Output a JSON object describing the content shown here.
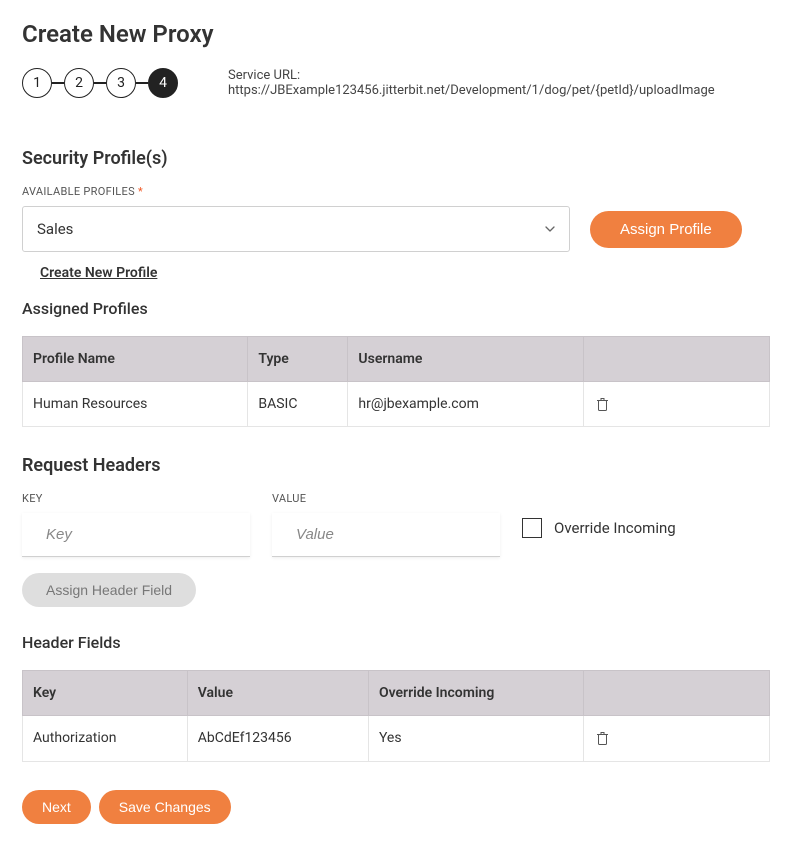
{
  "page_title": "Create New Proxy",
  "stepper": {
    "steps": [
      "1",
      "2",
      "3",
      "4"
    ],
    "active_index": 3
  },
  "service_url_label": "Service URL:",
  "service_url": "https://JBExample123456.jitterbit.net/Development/1/dog/pet/{petId}/uploadImage",
  "security": {
    "heading": "Security Profile(s)",
    "available_label": "AVAILABLE PROFILES",
    "selected_value": "Sales",
    "assign_button": "Assign Profile",
    "create_link": "Create New Profile",
    "assigned_title": "Assigned Profiles",
    "columns": [
      "Profile Name",
      "Type",
      "Username",
      ""
    ],
    "rows": [
      {
        "profile_name": "Human Resources",
        "type": "BASIC",
        "username": "hr@jbexample.com"
      }
    ]
  },
  "request_headers": {
    "heading": "Request Headers",
    "key_label": "KEY",
    "value_label": "VALUE",
    "key_placeholder": "Key",
    "value_placeholder": "Value",
    "override_label": "Override Incoming",
    "assign_button": "Assign Header Field"
  },
  "header_fields": {
    "heading": "Header Fields",
    "columns": [
      "Key",
      "Value",
      "Override Incoming",
      ""
    ],
    "rows": [
      {
        "key": "Authorization",
        "value": "AbCdEf123456",
        "override": "Yes"
      }
    ]
  },
  "footer": {
    "next": "Next",
    "save": "Save Changes"
  }
}
